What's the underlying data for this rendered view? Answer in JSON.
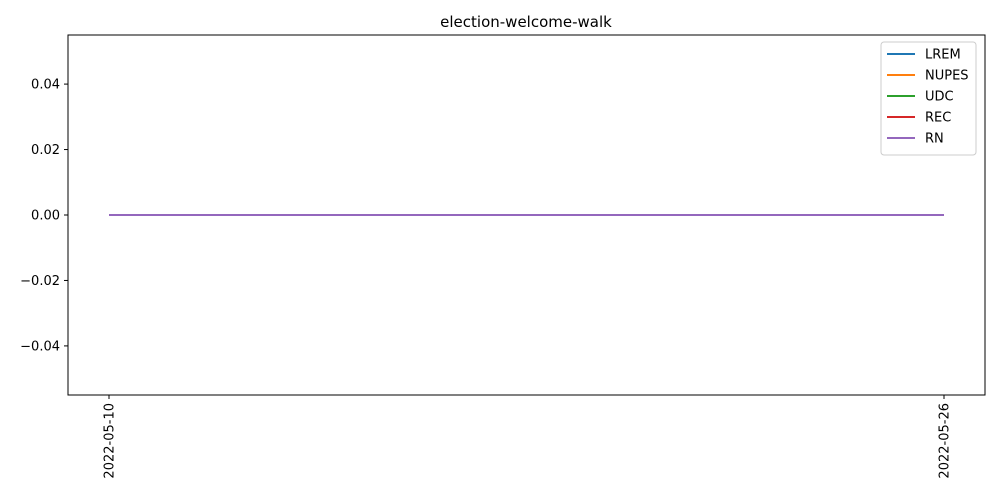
{
  "chart_data": {
    "type": "line",
    "title": "election-welcome-walk",
    "xlabel": "",
    "ylabel": "",
    "x": [
      "2022-05-10",
      "2022-05-26"
    ],
    "xticks": [
      "2022-05-10",
      "2022-05-26"
    ],
    "ylim": [
      -0.055,
      0.055
    ],
    "yticks": [
      -0.04,
      -0.02,
      0.0,
      0.02,
      0.04
    ],
    "ytick_labels": [
      "−0.04",
      "−0.02",
      "0.00",
      "0.02",
      "0.04"
    ],
    "grid": false,
    "legend_position": "top-right",
    "series": [
      {
        "name": "LREM",
        "color": "#1f77b4",
        "values": [
          0,
          0
        ]
      },
      {
        "name": "NUPES",
        "color": "#ff7f0e",
        "values": [
          0,
          0
        ]
      },
      {
        "name": "UDC",
        "color": "#2ca02c",
        "values": [
          0,
          0
        ]
      },
      {
        "name": "REC",
        "color": "#d62728",
        "values": [
          0,
          0
        ]
      },
      {
        "name": "RN",
        "color": "#9467bd",
        "values": [
          0,
          0
        ]
      }
    ]
  }
}
